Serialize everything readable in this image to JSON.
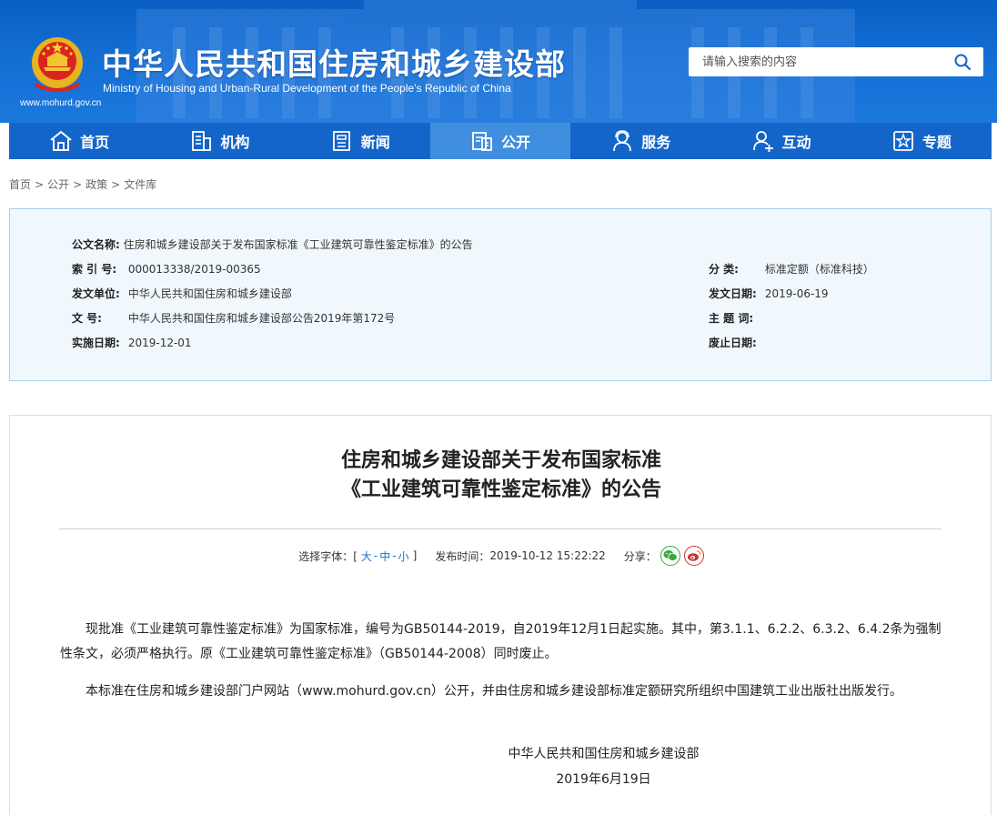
{
  "header": {
    "title": "中华人民共和国住房和城乡建设部",
    "subtitle": "Ministry of Housing and Urban-Rural Development of the People’s Republic of China",
    "url": "www.mohurd.gov.cn",
    "search_placeholder": "请输入搜索的内容",
    "colors": {
      "primary": "#1465c9",
      "active_nav": "#3f8ee0"
    }
  },
  "nav": {
    "items": [
      {
        "label": "首页",
        "icon": "home-icon"
      },
      {
        "label": "机构",
        "icon": "building-icon"
      },
      {
        "label": "新闻",
        "icon": "newspaper-icon"
      },
      {
        "label": "公开",
        "icon": "document-list-icon",
        "active": true
      },
      {
        "label": "服务",
        "icon": "service-person-icon"
      },
      {
        "label": "互动",
        "icon": "interaction-person-icon"
      },
      {
        "label": "专题",
        "icon": "star-badge-icon"
      }
    ]
  },
  "breadcrumb": [
    "首页",
    "公开",
    "政策",
    "文件库"
  ],
  "meta": {
    "doc_name_label": "公文名称:",
    "doc_name": "住房和城乡建设部关于发布国家标准《工业建筑可靠性鉴定标准》的公告",
    "index_label": "索  引  号:",
    "index": "000013338/2019-00365",
    "category_label": "分      类:",
    "category": "标准定额（标准科技）",
    "issuer_label": "发文单位:",
    "issuer": "中华人民共和国住房和城乡建设部",
    "issue_date_label": "发文日期:",
    "issue_date": "2019-06-19",
    "doc_no_label": "文       号:",
    "doc_no": "中华人民共和国住房和城乡建设部公告2019年第172号",
    "keywords_label": "主  题  词:",
    "keywords": "",
    "effective_label": "实施日期:",
    "effective": "2019-12-01",
    "repeal_label": "废止日期:",
    "repeal": ""
  },
  "article": {
    "title_line1": "住房和城乡建设部关于发布国家标准",
    "title_line2": "《工业建筑可靠性鉴定标准》的公告",
    "font_label": "选择字体：[",
    "font_large": "大",
    "font_medium": "中",
    "font_small": "小",
    "font_close": "]",
    "publish_label": "发布时间：",
    "publish_time": "2019-10-12 15:22:22",
    "share_label": "分享：",
    "para1": "现批准《工业建筑可靠性鉴定标准》为国家标准，编号为GB50144-2019，自2019年12月1日起实施。其中，第3.1.1、6.2.2、6.3.2、6.4.2条为强制性条文，必须严格执行。原《工业建筑可靠性鉴定标准》（GB50144-2008）同时废止。",
    "para2": "本标准在住房和城乡建设部门户网站（www.mohurd.gov.cn）公开，并由住房和城乡建设部标准定额研究所组织中国建筑工业出版社出版发行。",
    "sign_org": "中华人民共和国住房和城乡建设部",
    "sign_date": "2019年6月19日"
  }
}
